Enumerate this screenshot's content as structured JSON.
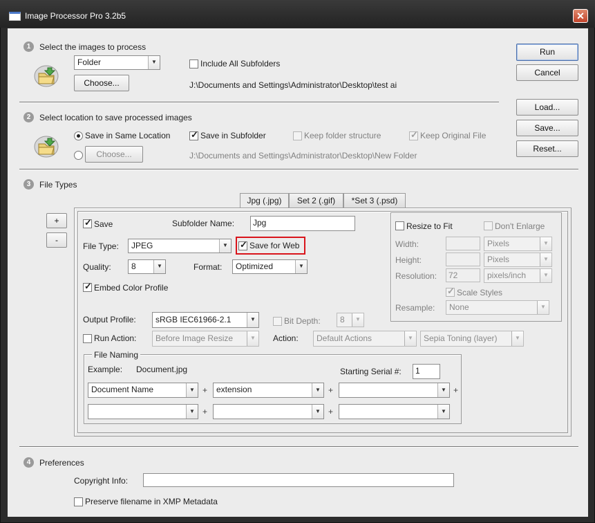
{
  "window": {
    "title": "Image Processor Pro 3.2b5"
  },
  "side_buttons": {
    "run": "Run",
    "cancel": "Cancel",
    "load": "Load...",
    "save": "Save...",
    "reset": "Reset..."
  },
  "section1": {
    "step": "1",
    "title": "Select the images to process",
    "source_select": "Folder",
    "choose": "Choose...",
    "include_subfolders": "Include All Subfolders",
    "path": "J:\\Documents and Settings\\Administrator\\Desktop\\test ai"
  },
  "section2": {
    "step": "2",
    "title": "Select location to save processed images",
    "same_location": "Save in Same Location",
    "choose": "Choose...",
    "save_in_subfolder": "Save in Subfolder",
    "keep_folder_structure": "Keep folder structure",
    "keep_original_file": "Keep Original File",
    "path": "J:\\Documents and Settings\\Administrator\\Desktop\\New Folder"
  },
  "section3": {
    "step": "3",
    "title": "File Types",
    "tabs": [
      "Jpg (.jpg)",
      "Set 2 (.gif)",
      "*Set 3 (.psd)"
    ],
    "add": "+",
    "remove": "-",
    "save_label": "Save",
    "subfolder_name_label": "Subfolder Name:",
    "subfolder_name_value": "Jpg",
    "file_type_label": "File Type:",
    "file_type_value": "JPEG",
    "save_for_web": "Save for Web",
    "quality_label": "Quality:",
    "quality_value": "8",
    "format_label": "Format:",
    "format_value": "Optimized",
    "embed_color_profile": "Embed Color Profile",
    "output_profile_label": "Output Profile:",
    "output_profile_value": "sRGB IEC61966-2.1",
    "bit_depth_label": "Bit Depth:",
    "bit_depth_value": "8",
    "run_action_label": "Run Action:",
    "run_action_value": "Before Image Resize",
    "action_label": "Action:",
    "action_set": "Default Actions",
    "action_name": "Sepia Toning (layer)",
    "resize": {
      "resize_to_fit": "Resize to Fit",
      "dont_enlarge": "Don't Enlarge",
      "width_label": "Width:",
      "width_unit": "Pixels",
      "height_label": "Height:",
      "height_unit": "Pixels",
      "resolution_label": "Resolution:",
      "resolution_value": "72",
      "resolution_unit": "pixels/inch",
      "scale_styles": "Scale Styles",
      "resample_label": "Resample:",
      "resample_value": "None"
    },
    "file_naming": {
      "title": "File Naming",
      "example_label": "Example:",
      "example_value": "Document.jpg",
      "serial_label": "Starting Serial #:",
      "serial_value": "1",
      "row1": [
        "Document Name",
        "extension",
        ""
      ],
      "plus": "+"
    }
  },
  "section4": {
    "step": "4",
    "title": "Preferences",
    "copyright_label": "Copyright Info:",
    "copyright_value": "",
    "preserve_filename": "Preserve filename in XMP Metadata"
  },
  "colors": {
    "highlight_box": "#d9141b",
    "title_bar": "#2a2a2a",
    "close_button": "#c94a2f"
  }
}
